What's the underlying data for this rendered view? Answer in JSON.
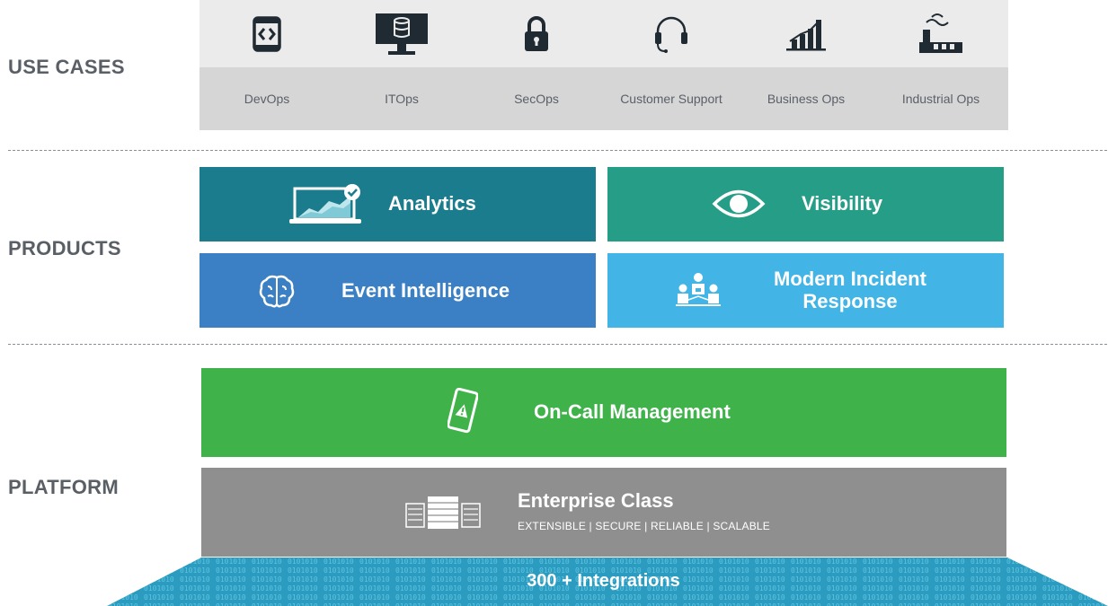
{
  "sections": {
    "use_cases": "USE CASES",
    "products": "PRODUCTS",
    "platform": "PLATFORM"
  },
  "use_cases": [
    {
      "label": "DevOps",
      "icon": "devops-code-icon"
    },
    {
      "label": "ITOps",
      "icon": "monitor-database-icon"
    },
    {
      "label": "SecOps",
      "icon": "padlock-icon"
    },
    {
      "label": "Customer Support",
      "icon": "headset-icon"
    },
    {
      "label": "Business Ops",
      "icon": "bar-chart-icon"
    },
    {
      "label": "Industrial Ops",
      "icon": "factory-icon"
    }
  ],
  "products": [
    {
      "label": "Analytics",
      "icon": "laptop-chart-icon",
      "color": "#1a7c8c"
    },
    {
      "label": "Visibility",
      "icon": "eye-icon",
      "color": "#269d86"
    },
    {
      "label": "Event Intelligence",
      "icon": "brain-icon",
      "color": "#3b80c4"
    },
    {
      "label_line1": "Modern Incident",
      "label_line2": "Response",
      "icon": "team-icon",
      "color": "#42b4e6"
    }
  ],
  "platform": {
    "on_call": {
      "label": "On-Call Management",
      "icon": "phone-alert-icon",
      "color": "#3fb24a"
    },
    "enterprise": {
      "title": "Enterprise Class",
      "subtitle": "EXTENSIBLE | SECURE | RELIABLE | SCALABLE",
      "icon": "servers-icon",
      "color": "#8f8f8f"
    },
    "integrations": {
      "label": "300 + Integrations",
      "color": "#2b9cc0"
    }
  }
}
